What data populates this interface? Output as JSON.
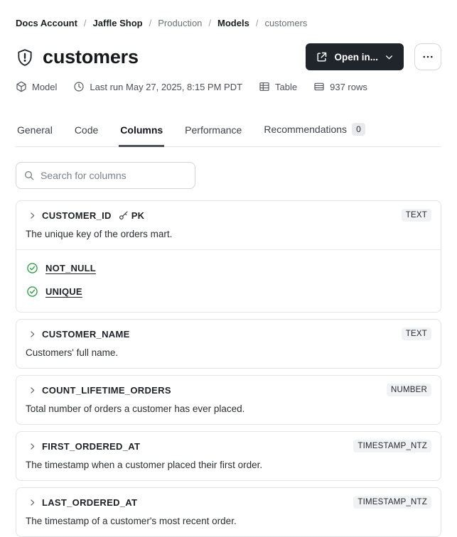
{
  "breadcrumb": {
    "separator": "/",
    "items": [
      {
        "label": "Docs Account",
        "muted": false
      },
      {
        "label": "Jaffle Shop",
        "muted": false
      },
      {
        "label": "Production",
        "muted": true
      },
      {
        "label": "Models",
        "muted": false
      },
      {
        "label": "customers",
        "muted": true
      }
    ]
  },
  "header": {
    "title": "customers",
    "open_in_label": "Open in..."
  },
  "meta": {
    "items": [
      {
        "icon": "cube-icon",
        "label": "Model"
      },
      {
        "icon": "clock-icon",
        "label": "Last run May 27, 2025, 8:15 PM PDT"
      },
      {
        "icon": "table-icon",
        "label": "Table"
      },
      {
        "icon": "rows-icon",
        "label": "937 rows"
      }
    ]
  },
  "tabs": [
    {
      "label": "General",
      "active": false
    },
    {
      "label": "Code",
      "active": false
    },
    {
      "label": "Columns",
      "active": true
    },
    {
      "label": "Performance",
      "active": false
    },
    {
      "label": "Recommendations",
      "active": false,
      "badge": "0"
    }
  ],
  "search": {
    "placeholder": "Search for columns"
  },
  "columns": [
    {
      "name": "CUSTOMER_ID",
      "pk_label": "PK",
      "type": "TEXT",
      "description": "The unique key of the orders mart.",
      "tests": [
        "NOT_NULL",
        "UNIQUE"
      ]
    },
    {
      "name": "CUSTOMER_NAME",
      "type": "TEXT",
      "description": "Customers' full name.",
      "tests": []
    },
    {
      "name": "COUNT_LIFETIME_ORDERS",
      "type": "NUMBER",
      "description": "Total number of orders a customer has ever placed.",
      "tests": []
    },
    {
      "name": "FIRST_ORDERED_AT",
      "type": "TIMESTAMP_NTZ",
      "description": "The timestamp when a customer placed their first order.",
      "tests": []
    },
    {
      "name": "LAST_ORDERED_AT",
      "type": "TIMESTAMP_NTZ",
      "description": "The timestamp of a customer's most recent order.",
      "tests": []
    }
  ],
  "colors": {
    "action_button_bg": "#20252b",
    "test_pass_green": "#319c46",
    "badge_bg": "#f1f2f4",
    "card_border": "#e2e4e7"
  }
}
